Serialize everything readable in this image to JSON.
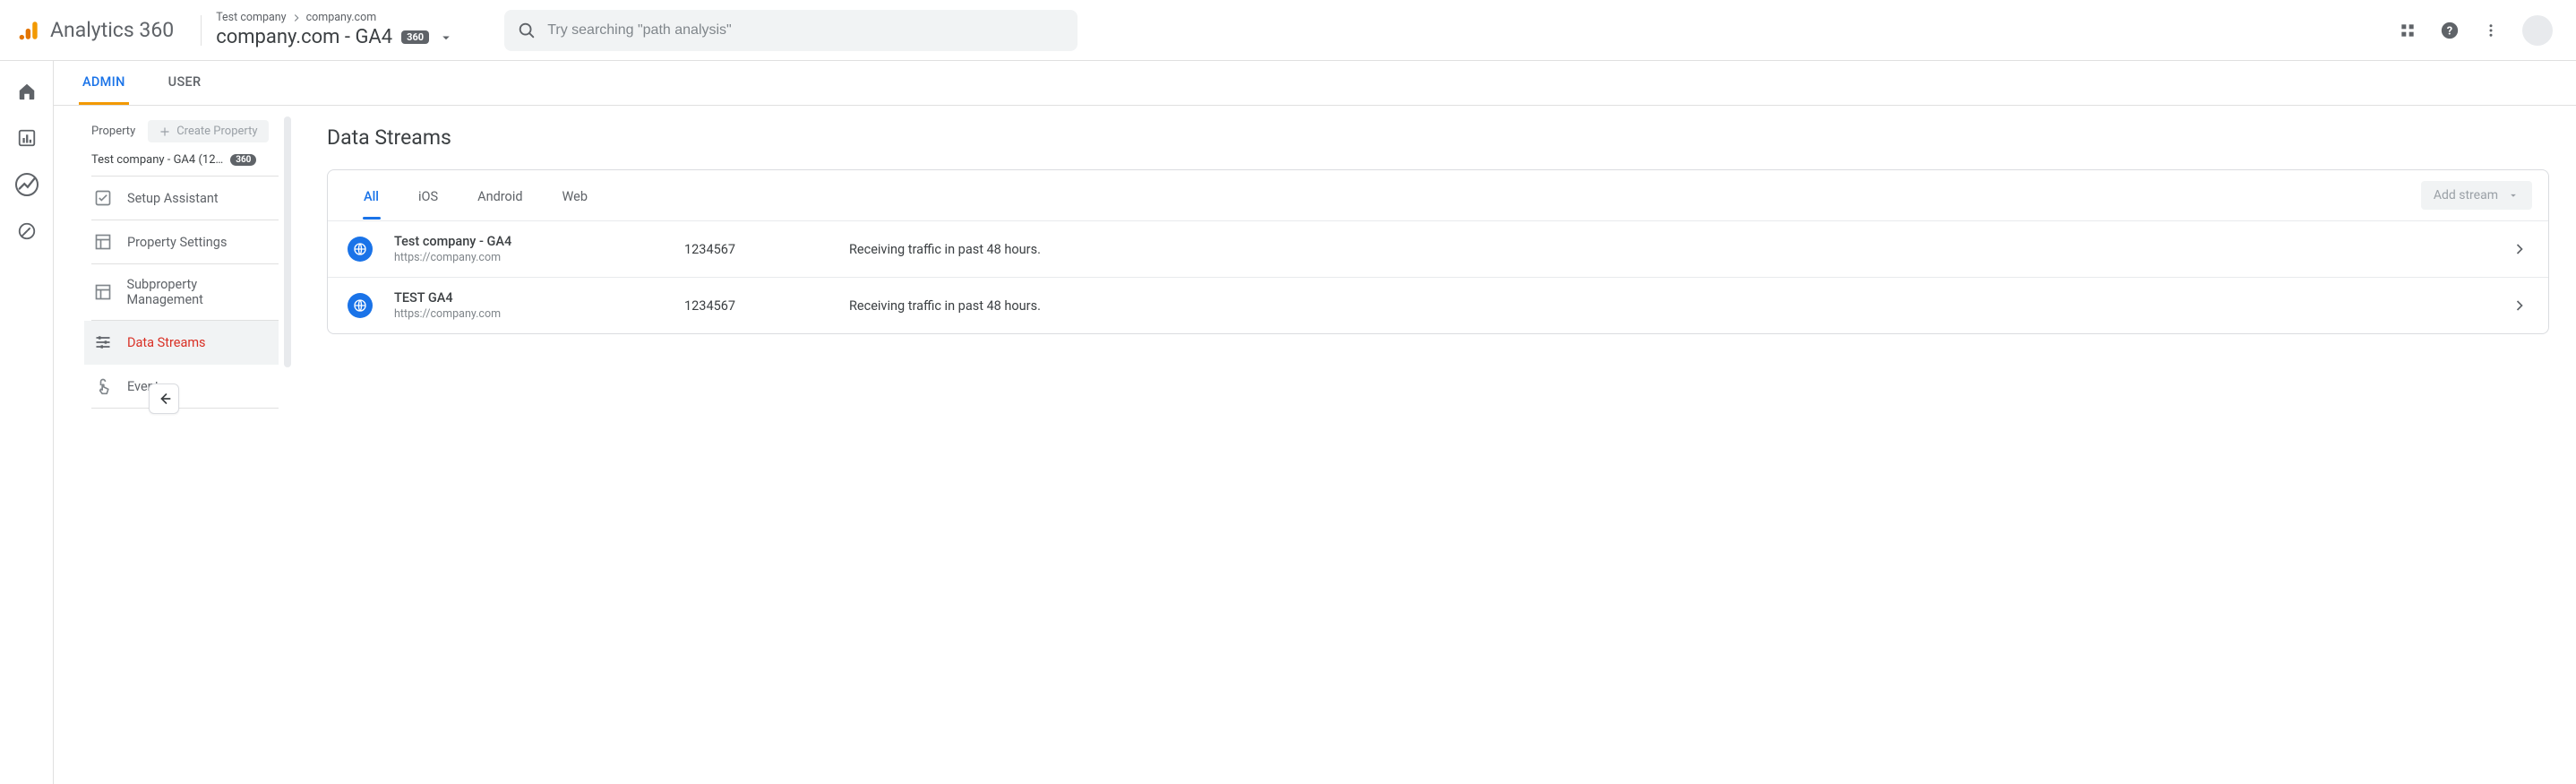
{
  "header": {
    "product_name": "Analytics 360",
    "breadcrumb": {
      "account": "Test company",
      "property_domain": "company.com"
    },
    "picker": {
      "title": "company.com - GA4",
      "badge": "360"
    },
    "search_placeholder": "Try searching \"path analysis\""
  },
  "admin_tabs": {
    "admin": "ADMIN",
    "user": "USER"
  },
  "settings_column": {
    "section_label": "Property",
    "create_label": "Create Property",
    "selected_property_label": "Test company - GA4 (12…",
    "selected_property_badge": "360",
    "items": [
      {
        "label": "Setup Assistant",
        "icon": "check-square-icon",
        "active": false
      },
      {
        "label": "Property Settings",
        "icon": "layout-icon",
        "active": false
      },
      {
        "label": "Subproperty Management",
        "icon": "layout-icon",
        "active": false
      },
      {
        "label": "Data Streams",
        "icon": "sliders-icon",
        "active": true
      },
      {
        "label": "Events",
        "icon": "tap-icon",
        "active": false
      }
    ]
  },
  "panel": {
    "title": "Data Streams",
    "stream_tabs": [
      "All",
      "iOS",
      "Android",
      "Web"
    ],
    "stream_tabs_active_index": 0,
    "add_stream_label": "Add stream",
    "streams": [
      {
        "name": "Test company - GA4",
        "url": "https://company.com",
        "id": "1234567",
        "status": "Receiving traffic in past 48 hours."
      },
      {
        "name": "TEST GA4",
        "url": "https://company.com",
        "id": "1234567",
        "status": "Receiving traffic in past 48 hours."
      }
    ]
  }
}
